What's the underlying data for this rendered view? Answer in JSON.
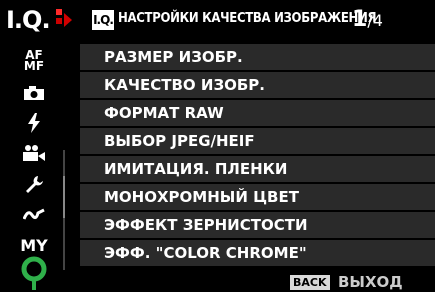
{
  "sidebar": {
    "tab_label": "I.Q.",
    "items": [
      {
        "name": "af-mf",
        "text": "AF\nMF"
      },
      {
        "name": "camera"
      },
      {
        "name": "flash"
      },
      {
        "name": "movie"
      },
      {
        "name": "wrench"
      },
      {
        "name": "custom-curve"
      },
      {
        "name": "my-menu",
        "text": "MY"
      }
    ]
  },
  "header": {
    "icon_text": "I.Q.",
    "title": "НАСТРОЙКИ КАЧЕСТВА ИЗОБРАЖЕНИЯ",
    "page_current": "1",
    "page_total": "/4"
  },
  "menu": {
    "items": [
      "РАЗМЕР ИЗОБР.",
      "КАЧЕСТВО ИЗОБР.",
      "ФОРМАТ RAW",
      "ВЫБОР JPEG/HEIF",
      "ИМИТАЦИЯ. ПЛЕНКИ",
      "МОНОХРОМНЫЙ ЦВЕТ",
      "ЭФФЕКТ ЗЕРНИСТОСТИ",
      "ЭФФ. \"COLOR CHROME\""
    ]
  },
  "footer": {
    "back_key": "BACK",
    "back_label": "ВЫХОД"
  },
  "colors": {
    "accent_red": "#d00000",
    "indicator_green": "#2fb04a",
    "row_bg": "#2a2a2a"
  }
}
